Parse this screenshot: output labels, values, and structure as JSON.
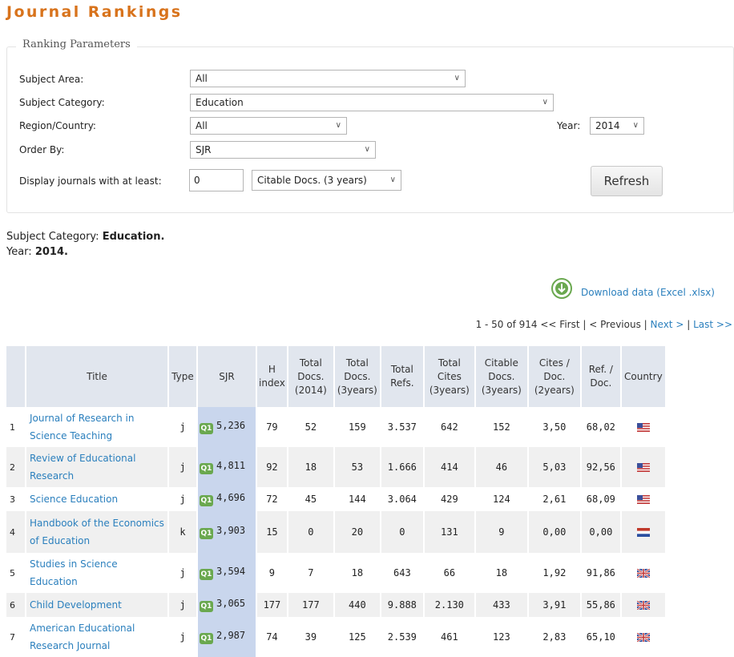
{
  "page": {
    "title": "Journal Rankings"
  },
  "params": {
    "legend": "Ranking Parameters",
    "subject_area": {
      "label": "Subject Area:",
      "value": "All"
    },
    "subject_category": {
      "label": "Subject Category:",
      "value": "Education"
    },
    "region": {
      "label": "Region/Country:",
      "value": "All"
    },
    "year": {
      "label": "Year:",
      "value": "2014"
    },
    "order_by": {
      "label": "Order By:",
      "value": "SJR"
    },
    "min_display": {
      "label": "Display journals with at least:",
      "value": "0",
      "unit": "Citable Docs. (3 years)"
    },
    "refresh_label": "Refresh"
  },
  "summary": {
    "category_label": "Subject Category: ",
    "category_value": "Education.",
    "year_label": "Year: ",
    "year_value": "2014."
  },
  "download": {
    "label": "Download data (Excel .xlsx)",
    "icon": "download-icon",
    "icon_color": "#6aa84f"
  },
  "pager": {
    "range": "1 - 50 of 914",
    "first": "<< First",
    "sep1": "|",
    "previous": "< Previous",
    "sep2": "|",
    "next": "Next >",
    "sep3": "|",
    "last": "Last >>"
  },
  "table": {
    "columns": {
      "title": "Title",
      "type": "Type",
      "sjr": "SJR",
      "h_index": [
        "H",
        "index"
      ],
      "total_docs_2014": [
        "Total",
        "Docs.",
        "(2014)"
      ],
      "total_docs_3y": [
        "Total",
        "Docs.",
        "(3years)"
      ],
      "total_refs": [
        "Total",
        "Refs."
      ],
      "total_cites_3y": [
        "Total",
        "Cites",
        "(3years)"
      ],
      "citable_docs_3y": [
        "Citable",
        "Docs.",
        "(3years)"
      ],
      "cites_doc_2y": [
        "Cites /",
        "Doc.",
        "(2years)"
      ],
      "ref_doc": [
        "Ref. /",
        "Doc."
      ],
      "country": "Country"
    },
    "rows": [
      {
        "rank": "1",
        "title": "Journal of Research in Science Teaching",
        "type": "j",
        "quartile": "Q1",
        "sjr": "5,236",
        "h": "79",
        "docs2014": "52",
        "docs3y": "159",
        "refs": "3.537",
        "cites3y": "642",
        "citable3y": "152",
        "cites_doc": "3,50",
        "ref_doc": "68,02",
        "country": "us"
      },
      {
        "rank": "2",
        "title": "Review of Educational Research",
        "type": "j",
        "quartile": "Q1",
        "sjr": "4,811",
        "h": "92",
        "docs2014": "18",
        "docs3y": "53",
        "refs": "1.666",
        "cites3y": "414",
        "citable3y": "46",
        "cites_doc": "5,03",
        "ref_doc": "92,56",
        "country": "us"
      },
      {
        "rank": "3",
        "title": "Science Education",
        "type": "j",
        "quartile": "Q1",
        "sjr": "4,696",
        "h": "72",
        "docs2014": "45",
        "docs3y": "144",
        "refs": "3.064",
        "cites3y": "429",
        "citable3y": "124",
        "cites_doc": "2,61",
        "ref_doc": "68,09",
        "country": "us"
      },
      {
        "rank": "4",
        "title": "Handbook of the Economics of Education",
        "type": "k",
        "quartile": "Q1",
        "sjr": "3,903",
        "h": "15",
        "docs2014": "0",
        "docs3y": "20",
        "refs": "0",
        "cites3y": "131",
        "citable3y": "9",
        "cites_doc": "0,00",
        "ref_doc": "0,00",
        "country": "nl"
      },
      {
        "rank": "5",
        "title": "Studies in Science Education",
        "type": "j",
        "quartile": "Q1",
        "sjr": "3,594",
        "h": "9",
        "docs2014": "7",
        "docs3y": "18",
        "refs": "643",
        "cites3y": "66",
        "citable3y": "18",
        "cites_doc": "1,92",
        "ref_doc": "91,86",
        "country": "gb"
      },
      {
        "rank": "6",
        "title": "Child Development",
        "type": "j",
        "quartile": "Q1",
        "sjr": "3,065",
        "h": "177",
        "docs2014": "177",
        "docs3y": "440",
        "refs": "9.888",
        "cites3y": "2.130",
        "citable3y": "433",
        "cites_doc": "3,91",
        "ref_doc": "55,86",
        "country": "gb"
      },
      {
        "rank": "7",
        "title": "American Educational Research Journal",
        "type": "j",
        "quartile": "Q1",
        "sjr": "2,987",
        "h": "74",
        "docs2014": "39",
        "docs3y": "125",
        "refs": "2.539",
        "cites3y": "461",
        "citable3y": "123",
        "cites_doc": "2,83",
        "ref_doc": "65,10",
        "country": "gb"
      }
    ]
  },
  "colors": {
    "title_orange": "#d8731c",
    "link_blue": "#2a7fbd",
    "header_bg": "#e1e6ee",
    "sjr_highlight": "#c9d6ed",
    "quartile_green": "#6aa84f"
  }
}
